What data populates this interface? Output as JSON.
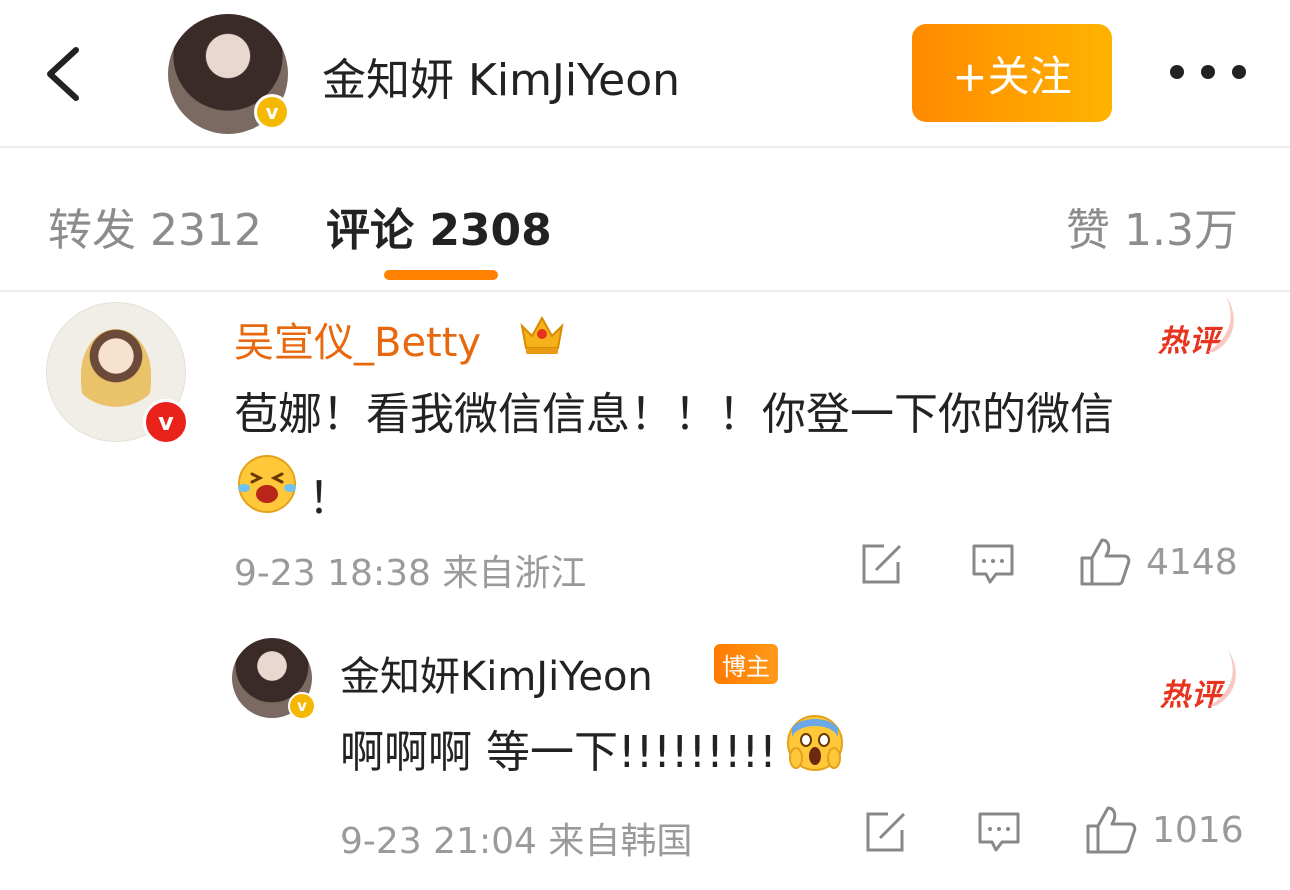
{
  "header": {
    "title": "金知妍 KimJiYeon",
    "follow_label": "+关注",
    "icons": [
      "back-icon",
      "verified-badge",
      "more-icon"
    ]
  },
  "tabs": {
    "repost": "转发 2312",
    "comments": "评论 2308",
    "likes": "赞 1.3万",
    "active": "comments",
    "accent_color": "#ff8200"
  },
  "comments": [
    {
      "username": "吴宣仪_Betty",
      "hot_label": "热评",
      "text": "苞娜！看我微信信息！！！你登一下你的微信",
      "text_line2": "！",
      "emoji": "crying-laugh-emoji",
      "meta": "9-23 18:38 来自浙江",
      "likes": "4148",
      "name_color": "#e8680e",
      "replies": [
        {
          "username": "金知妍KimJiYeon",
          "badge": "博主",
          "hot_label": "热评",
          "text": "啊啊啊 等一下!!!!!!!!!",
          "emoji": "scream-emoji",
          "meta": "9-23 21:04 来自韩国",
          "likes": "1016"
        }
      ]
    }
  ]
}
